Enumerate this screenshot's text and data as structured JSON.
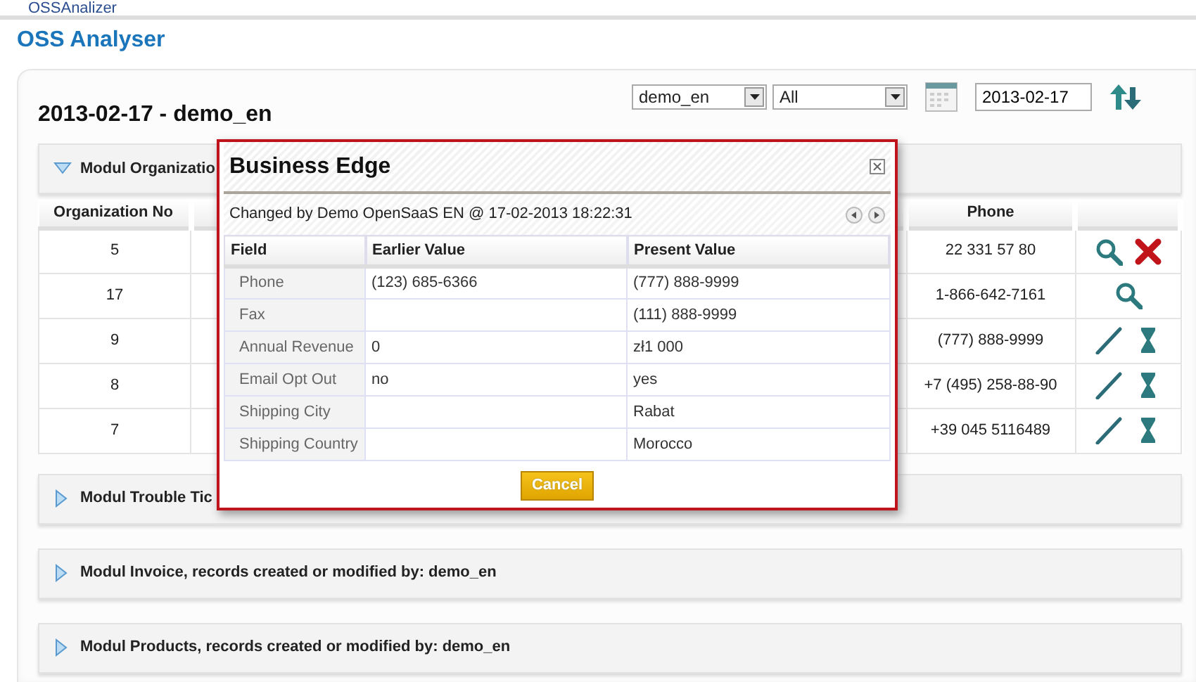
{
  "top_link": "OSSAnalizer",
  "app_title": "OSS Analyser",
  "panel": {
    "heading": "2013-02-17 - demo_en",
    "user_select": "demo_en",
    "filter_select": "All",
    "date": "2013-02-17"
  },
  "modules": [
    {
      "title": "Modul Organizatio",
      "expanded": true,
      "table": {
        "columns": [
          "Organization No",
          "",
          "Phone",
          ""
        ],
        "rows": [
          {
            "number": "5",
            "phone": "22 331 57 80",
            "actions": [
              {
                "kind": "view"
              },
              {
                "kind": "delete"
              }
            ]
          },
          {
            "number": "17",
            "phone": "1-866-642-7161",
            "actions": [
              {
                "kind": "view"
              }
            ]
          },
          {
            "number": "9",
            "phone": "(777) 888-9999",
            "actions": [
              {
                "kind": "edit"
              },
              {
                "kind": "history"
              }
            ]
          },
          {
            "number": "8",
            "phone": "+7 (495) 258-88-90",
            "actions": [
              {
                "kind": "edit"
              },
              {
                "kind": "history"
              }
            ]
          },
          {
            "number": "7",
            "phone": "+39 045 5116489",
            "actions": [
              {
                "kind": "edit"
              },
              {
                "kind": "history"
              }
            ]
          }
        ]
      }
    },
    {
      "title": "Modul Trouble Tic",
      "expanded": false
    },
    {
      "title": "Modul Invoice, records created or modified by: demo_en",
      "expanded": false
    },
    {
      "title": "Modul Products, records created or modified by: demo_en",
      "expanded": false
    }
  ],
  "dialog": {
    "title": "Business Edge",
    "subtitle": "Changed by Demo OpenSaaS EN @ 17-02-2013 18:22:31",
    "columns": [
      "Field",
      "Earlier Value",
      "Present Value"
    ],
    "rows": [
      [
        "Phone",
        "(123) 685-6366",
        "(777) 888-9999"
      ],
      [
        "Fax",
        "",
        "(111) 888-9999"
      ],
      [
        "Annual Revenue",
        "0",
        "zł1 000"
      ],
      [
        "Email Opt Out",
        "no",
        "yes"
      ],
      [
        "Shipping City",
        "",
        "Rabat"
      ],
      [
        "Shipping Country",
        "",
        "Morocco"
      ]
    ],
    "button": "Cancel"
  }
}
